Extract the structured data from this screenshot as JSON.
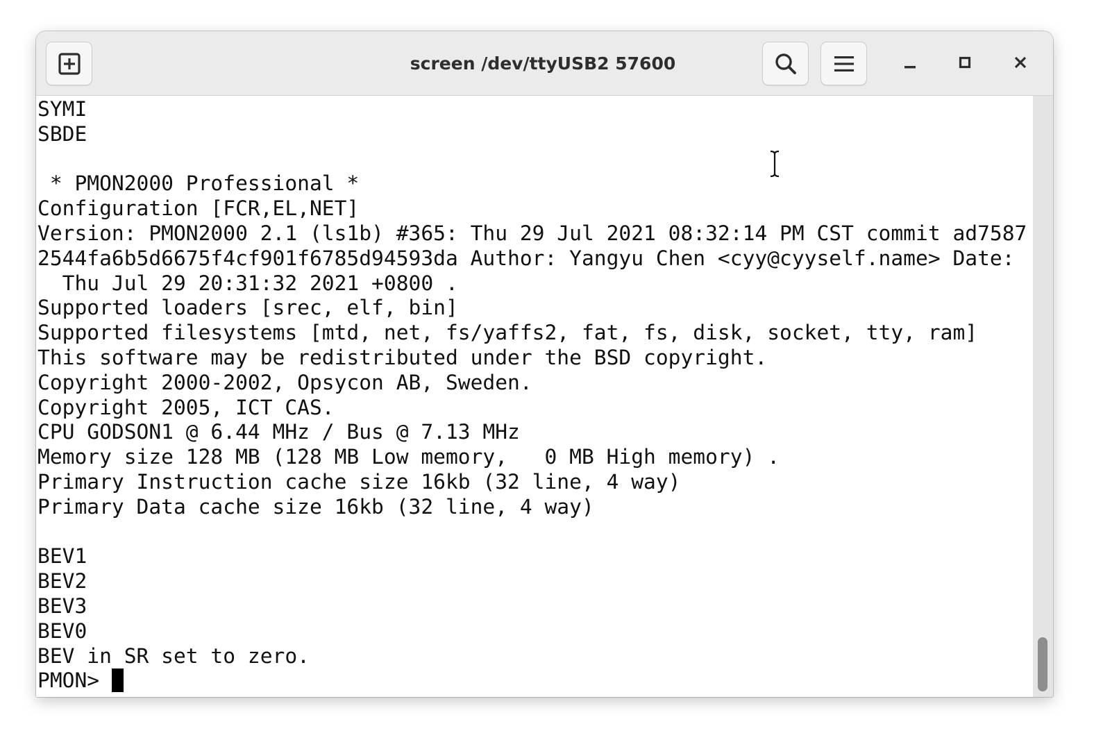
{
  "window": {
    "title": "screen /dev/ttyUSB2 57600"
  },
  "toolbar": {
    "new_tab_icon": "new-tab-icon",
    "search_icon": "search-icon",
    "menu_icon": "hamburger-menu-icon",
    "minimize_icon": "minimize-icon",
    "maximize_icon": "maximize-icon",
    "close_icon": "close-icon"
  },
  "terminal": {
    "lines": [
      "SYMI",
      "SBDE",
      "",
      " * PMON2000 Professional *",
      "Configuration [FCR,EL,NET]",
      "Version: PMON2000 2.1 (ls1b) #365: Thu 29 Jul 2021 08:32:14 PM CST commit ad7587",
      "2544fa6b5d6675f4cf901f6785d94593da Author: Yangyu Chen <cyy@cyyself.name> Date:",
      "  Thu Jul 29 20:31:32 2021 +0800 .",
      "Supported loaders [srec, elf, bin]",
      "Supported filesystems [mtd, net, fs/yaffs2, fat, fs, disk, socket, tty, ram]",
      "This software may be redistributed under the BSD copyright.",
      "Copyright 2000-2002, Opsycon AB, Sweden.",
      "Copyright 2005, ICT CAS.",
      "CPU GODSON1 @ 6.44 MHz / Bus @ 7.13 MHz",
      "Memory size 128 MB (128 MB Low memory,   0 MB High memory) .",
      "Primary Instruction cache size 16kb (32 line, 4 way)",
      "Primary Data cache size 16kb (32 line, 4 way)",
      "",
      "BEV1",
      "BEV2",
      "BEV3",
      "BEV0",
      "BEV in SR set to zero."
    ],
    "prompt": "PMON> "
  },
  "colors": {
    "titlebar_bg": "#ebebeb",
    "terminal_bg": "#ffffff",
    "terminal_fg": "#111111",
    "scrollbar_thumb": "#8e8e8e"
  }
}
